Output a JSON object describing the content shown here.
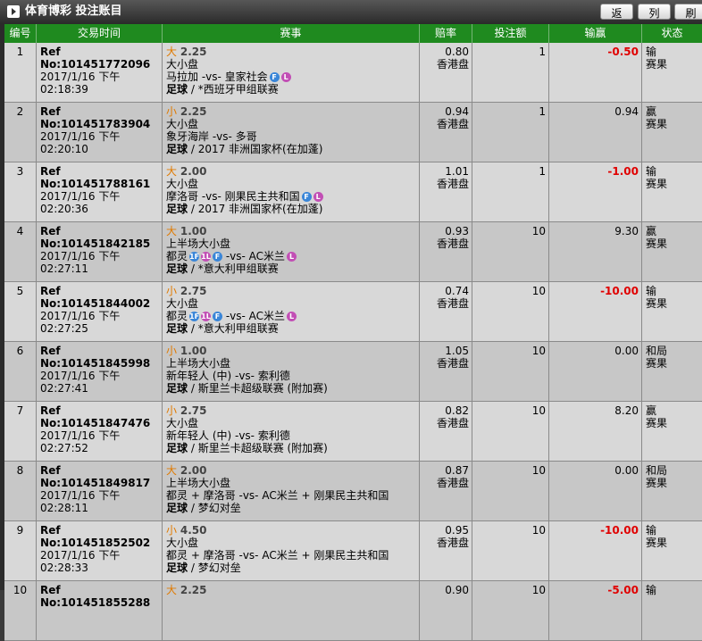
{
  "header": {
    "title": "体育博彩 投注账目",
    "buttons": [
      {
        "label": "返回"
      },
      {
        "label": "列印"
      },
      {
        "label": "刷新"
      }
    ]
  },
  "columns": [
    "编号",
    "交易时间",
    "赛事",
    "赔率",
    "投注额",
    "输赢",
    "状态"
  ],
  "rows": [
    {
      "no": "1",
      "ref": "Ref No:101451772096",
      "time": "2017/1/16 下午 02:18:39",
      "sel": "大",
      "sel_val": "2.25",
      "market": "大小盘",
      "match": "马拉加 -vs- 皇家社会",
      "badges": [
        "F",
        "L"
      ],
      "sport": "足球",
      "league": "*西班牙甲组联赛",
      "odds": "0.80",
      "odds_type": "香港盘",
      "stake": "1",
      "win": "-0.50",
      "status": "输",
      "status2": "赛果"
    },
    {
      "no": "2",
      "ref": "Ref No:101451783904",
      "time": "2017/1/16 下午 02:20:10",
      "sel": "小",
      "sel_val": "2.25",
      "market": "大小盘",
      "match": "象牙海岸 -vs- 多哥",
      "badges": [],
      "sport": "足球",
      "league": "2017 非洲国家杯(在加蓬)",
      "odds": "0.94",
      "odds_type": "香港盘",
      "stake": "1",
      "win": "0.94",
      "status": "赢",
      "status2": "赛果"
    },
    {
      "no": "3",
      "ref": "Ref No:101451788161",
      "time": "2017/1/16 下午 02:20:36",
      "sel": "大",
      "sel_val": "2.00",
      "market": "大小盘",
      "match": "摩洛哥 -vs- 刚果民主共和国",
      "badges": [
        "F",
        "L"
      ],
      "sport": "足球",
      "league": "2017 非洲国家杯(在加蓬)",
      "odds": "1.01",
      "odds_type": "香港盘",
      "stake": "1",
      "win": "-1.00",
      "status": "输",
      "status2": "赛果"
    },
    {
      "no": "4",
      "ref": "Ref No:101451842185",
      "time": "2017/1/16 下午 02:27:11",
      "sel": "大",
      "sel_val": "1.00",
      "market": "上半场大小盘",
      "match": "都灵",
      "badges": [
        "1F",
        "1L",
        "F"
      ],
      "match2": "-vs- AC米兰",
      "badges2": [
        "L"
      ],
      "sport": "足球",
      "league": "*意大利甲组联赛",
      "odds": "0.93",
      "odds_type": "香港盘",
      "stake": "10",
      "win": "9.30",
      "status": "赢",
      "status2": "赛果"
    },
    {
      "no": "5",
      "ref": "Ref No:101451844002",
      "time": "2017/1/16 下午 02:27:25",
      "sel": "小",
      "sel_val": "2.75",
      "market": "大小盘",
      "match": "都灵",
      "badges": [
        "1F",
        "1L",
        "F"
      ],
      "match2": "-vs- AC米兰",
      "badges2": [
        "L"
      ],
      "sport": "足球",
      "league": "*意大利甲组联赛",
      "odds": "0.74",
      "odds_type": "香港盘",
      "stake": "10",
      "win": "-10.00",
      "status": "输",
      "status2": "赛果"
    },
    {
      "no": "6",
      "ref": "Ref No:101451845998",
      "time": "2017/1/16 下午 02:27:41",
      "sel": "小",
      "sel_val": "1.00",
      "market": "上半场大小盘",
      "match": "新年轻人 (中) -vs- 索利德",
      "badges": [],
      "sport": "足球",
      "league": "斯里兰卡超级联赛 (附加赛)",
      "odds": "1.05",
      "odds_type": "香港盘",
      "stake": "10",
      "win": "0.00",
      "status": "和局",
      "status2": "赛果"
    },
    {
      "no": "7",
      "ref": "Ref No:101451847476",
      "time": "2017/1/16 下午 02:27:52",
      "sel": "小",
      "sel_val": "2.75",
      "market": "大小盘",
      "match": "新年轻人 (中) -vs- 索利德",
      "badges": [],
      "sport": "足球",
      "league": "斯里兰卡超级联赛 (附加赛)",
      "odds": "0.82",
      "odds_type": "香港盘",
      "stake": "10",
      "win": "8.20",
      "status": "赢",
      "status2": "赛果"
    },
    {
      "no": "8",
      "ref": "Ref No:101451849817",
      "time": "2017/1/16 下午 02:28:11",
      "sel": "大",
      "sel_val": "2.00",
      "market": "上半场大小盘",
      "match": "都灵 + 摩洛哥 -vs- AC米兰 + 刚果民主共和国",
      "badges": [],
      "sport": "足球",
      "league": "梦幻对垒",
      "odds": "0.87",
      "odds_type": "香港盘",
      "stake": "10",
      "win": "0.00",
      "status": "和局",
      "status2": "赛果"
    },
    {
      "no": "9",
      "ref": "Ref No:101451852502",
      "time": "2017/1/16 下午 02:28:33",
      "sel": "小",
      "sel_val": "4.50",
      "market": "大小盘",
      "match": "都灵 + 摩洛哥 -vs- AC米兰 + 刚果民主共和国",
      "badges": [],
      "sport": "足球",
      "league": "梦幻对垒",
      "odds": "0.95",
      "odds_type": "香港盘",
      "stake": "10",
      "win": "-10.00",
      "status": "输",
      "status2": "赛果"
    },
    {
      "no": "10",
      "ref": "Ref No:101451855288",
      "time": "",
      "sel": "大",
      "sel_val": "2.25",
      "market": "",
      "match": "",
      "badges": [],
      "sport": "",
      "league": "",
      "odds": "0.90",
      "odds_type": "",
      "stake": "10",
      "win": "-5.00",
      "status": "输",
      "status2": ""
    }
  ]
}
